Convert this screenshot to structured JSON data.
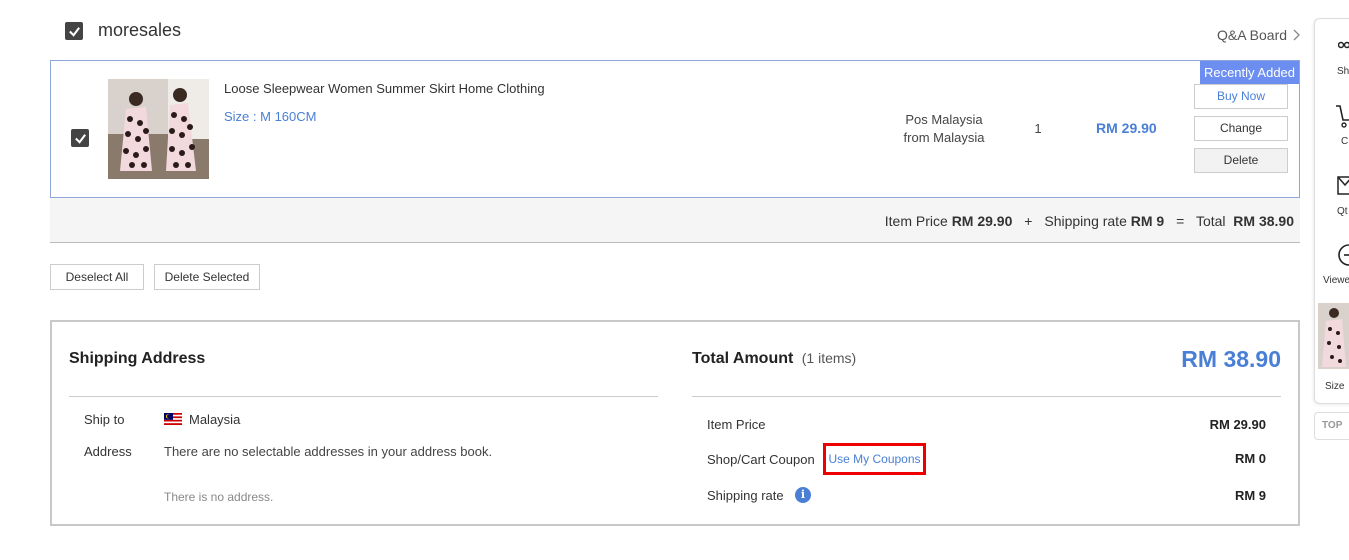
{
  "shop": {
    "name": "moresales",
    "qa_link": "Q&A Board"
  },
  "item": {
    "title": "Loose Sleepwear Women Summer Skirt Home Clothing",
    "option": "Size : M 160CM",
    "ship_from_line1": "Pos Malaysia",
    "ship_from_line2": "from Malaysia",
    "quantity": "1",
    "price": "RM 29.90",
    "badge": "Recently Added",
    "buy_now": "Buy Now",
    "change": "Change",
    "delete": "Delete"
  },
  "summary": {
    "item_price_label": "Item Price",
    "item_price": "RM 29.90",
    "plus": "+",
    "shipping_label": "Shipping rate",
    "shipping": "RM 9",
    "equals": "=",
    "total_label": "Total",
    "total": "RM 38.90"
  },
  "selection": {
    "deselect_all": "Deselect All",
    "delete_selected": "Delete Selected"
  },
  "shipping_address": {
    "heading": "Shipping Address",
    "ship_to_label": "Ship to",
    "country": "Malaysia",
    "address_label": "Address",
    "address_message": "There are no selectable addresses in your address book.",
    "no_address": "There is no address."
  },
  "total_amount": {
    "heading": "Total Amount",
    "count": "(1 items)",
    "grand_total": "RM 38.90",
    "rows": [
      {
        "label": "Item Price",
        "value": "RM 29.90"
      },
      {
        "label": "Shop/Cart Coupon",
        "value": "RM 0"
      },
      {
        "label": "Shipping rate",
        "value": "RM 9"
      }
    ],
    "coupon_button": "Use My Coupons",
    "info_icon": "i"
  },
  "side_panel": {
    "labels": [
      "Sh",
      "C",
      "Qt",
      "Viewe",
      "Size"
    ],
    "top": "TOP"
  },
  "colors": {
    "accent": "#4a7fd6",
    "badge": "#6b8ef0",
    "highlight_border": "#ee0000"
  }
}
